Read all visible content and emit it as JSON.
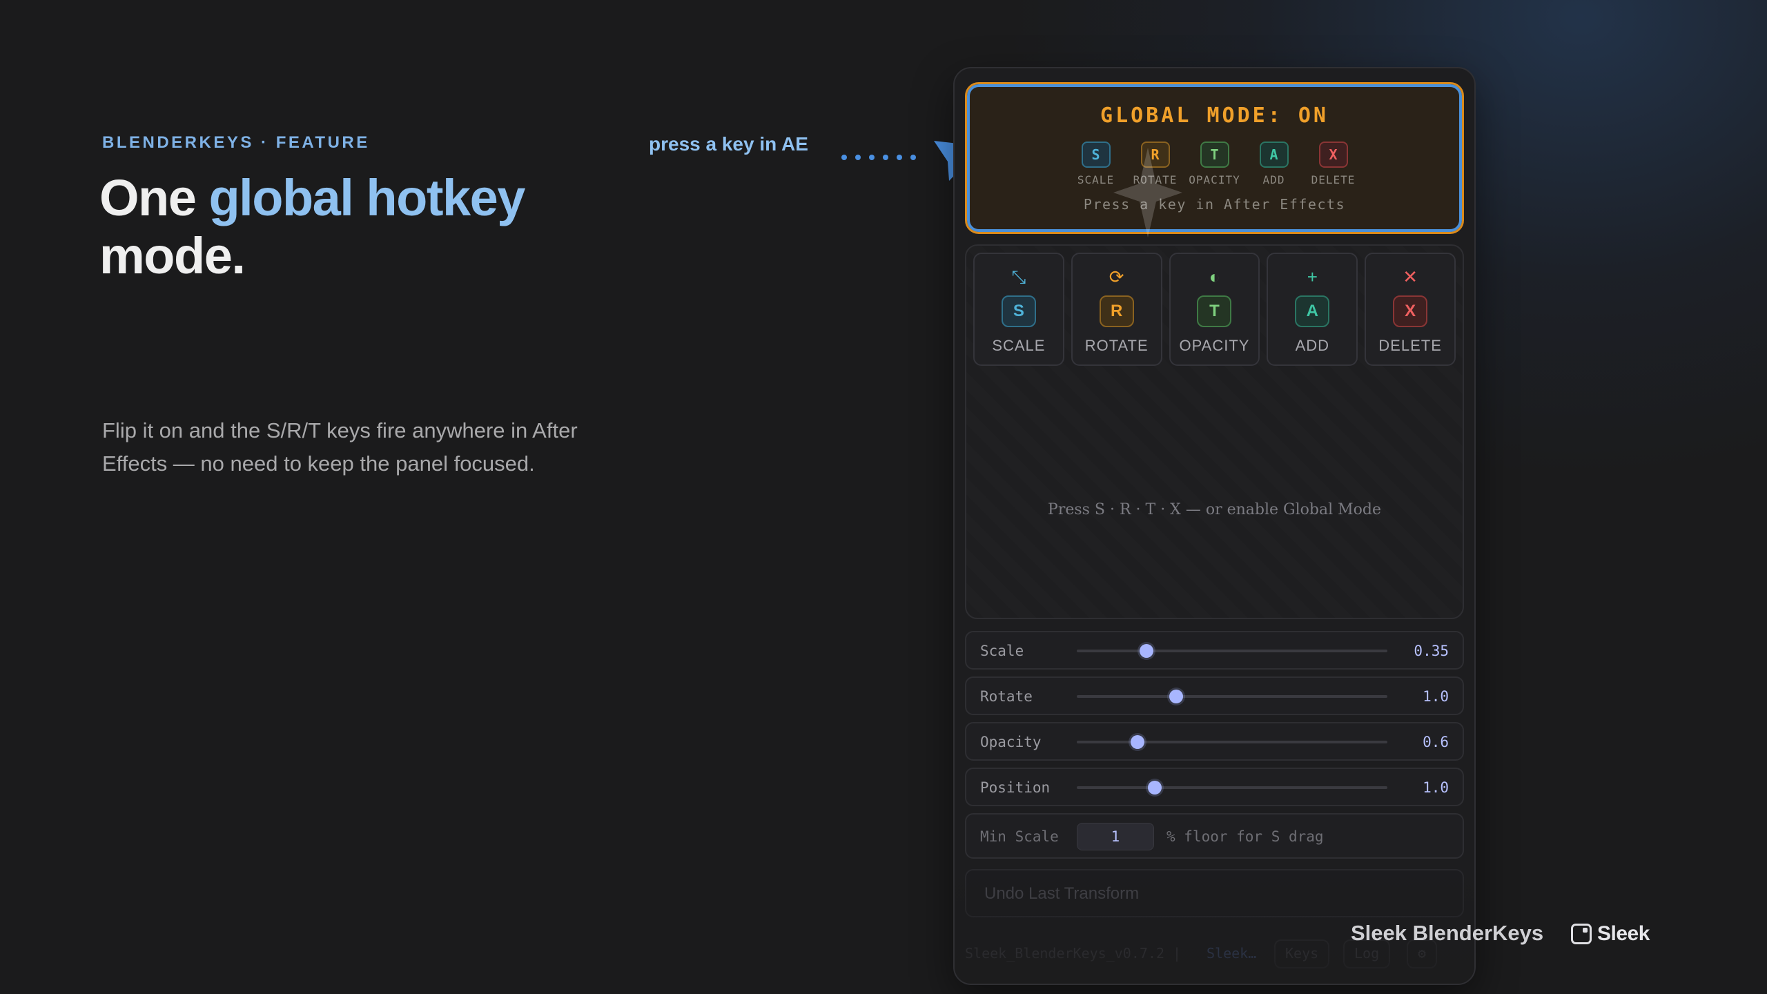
{
  "eyebrow": "BLENDERKEYS · FEATURE",
  "headline": {
    "part1": "One ",
    "accent": "global hotkey",
    "part2": "mode."
  },
  "description": "Flip it on and the S/R/T keys fire anywhere in After Effects — no need to keep the panel focused.",
  "callout": "press a key in AE",
  "global_mode": {
    "title": "GLOBAL MODE: ON",
    "hint": "Press a key in After Effects",
    "keys": [
      {
        "key": "S",
        "label": "SCALE",
        "color": "#4fb3d9"
      },
      {
        "key": "R",
        "label": "ROTATE",
        "color": "#f0a02a"
      },
      {
        "key": "T",
        "label": "OPACITY",
        "color": "#7fd17f"
      },
      {
        "key": "A",
        "label": "ADD",
        "color": "#3fc7a5"
      },
      {
        "key": "X",
        "label": "DELETE",
        "color": "#f06060"
      }
    ]
  },
  "tools": {
    "hint": "Press S · R · T · X — or enable Global Mode",
    "items": [
      {
        "icon": "⤡",
        "key": "S",
        "label": "SCALE",
        "color": "#4fb3d9"
      },
      {
        "icon": "⟳",
        "key": "R",
        "label": "ROTATE",
        "color": "#f0a02a"
      },
      {
        "icon": "◐",
        "key": "T",
        "label": "OPACITY",
        "color": "#7fd17f"
      },
      {
        "icon": "+",
        "key": "A",
        "label": "ADD",
        "color": "#3fc7a5"
      },
      {
        "icon": "✕",
        "key": "X",
        "label": "DELETE",
        "color": "#f06060"
      }
    ]
  },
  "sliders": [
    {
      "label": "Scale",
      "value": "0.35",
      "fraction": 0.225
    },
    {
      "label": "Rotate",
      "value": "1.0",
      "fraction": 0.32
    },
    {
      "label": "Opacity",
      "value": "0.6",
      "fraction": 0.195
    },
    {
      "label": "Position",
      "value": "1.0",
      "fraction": 0.25
    }
  ],
  "min_scale": {
    "label": "Min Scale",
    "value": "1",
    "note": "% floor for S drag"
  },
  "undo_label": "Undo Last Transform",
  "footer": {
    "version": "Sleek_BlenderKeys_v0.7.2 |",
    "brand": "Sleek…",
    "keys_btn": "Keys",
    "log_btn": "Log"
  },
  "watermark": {
    "product": "Sleek BlenderKeys",
    "brand": "Sleek"
  }
}
